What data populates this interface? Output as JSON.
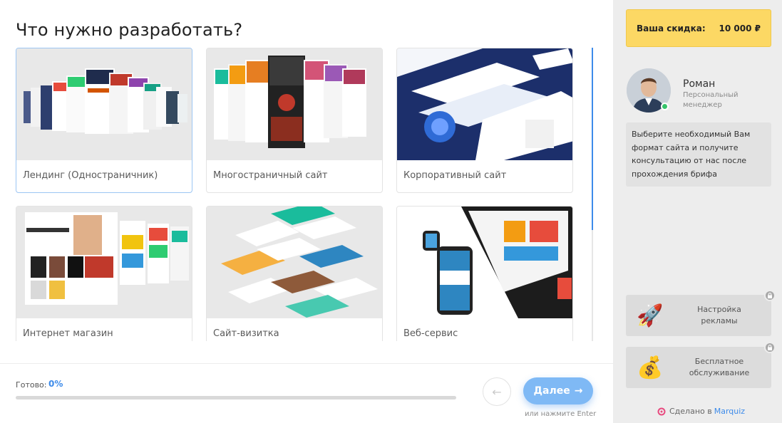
{
  "question": "Что нужно разработать?",
  "options": [
    {
      "label": "Лендинг (Одностраничник)",
      "selected": true
    },
    {
      "label": "Многостраничный сайт",
      "selected": false
    },
    {
      "label": "Корпоративный сайт",
      "selected": false
    },
    {
      "label": "Интернет магазин",
      "selected": false
    },
    {
      "label": "Сайт-визитка",
      "selected": false
    },
    {
      "label": "Веб-сервис",
      "selected": false
    }
  ],
  "progress": {
    "label": "Готово:",
    "value": "0%",
    "percent": 0
  },
  "navigation": {
    "next_label": "Далее",
    "next_icon": "arrow-right-icon",
    "back_icon": "arrow-left-icon",
    "enter_hint": "или нажмите Enter"
  },
  "sidebar": {
    "discount": {
      "label": "Ваша скидка:",
      "value": "10 000 ₽"
    },
    "manager": {
      "name": "Роман",
      "role": "Персональный менеджер",
      "message": "Выберите необходимый Вам формат сайта и получите консультацию от нас после прохождения брифа"
    },
    "bonuses": [
      {
        "label": "Настройка рекламы",
        "icon": "rocket-icon"
      },
      {
        "label": "Бесплатное обслуживание",
        "icon": "money-bag-icon"
      }
    ],
    "made_with": {
      "prefix": "Сделано в",
      "brand": "Marquiz"
    }
  },
  "colors": {
    "accent": "#3d8bea",
    "discount_bg": "#fcd864",
    "next_button": "#7fb9f5",
    "sidebar_bg": "#ededed"
  }
}
